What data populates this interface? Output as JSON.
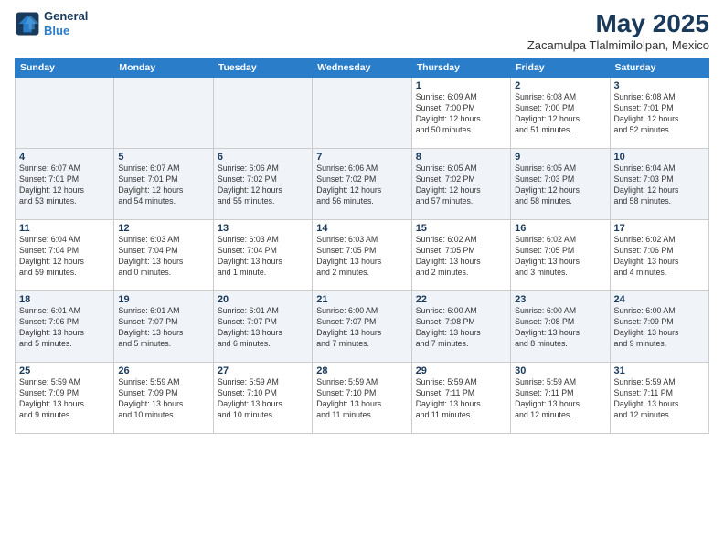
{
  "header": {
    "logo_line1": "General",
    "logo_line2": "Blue",
    "month": "May 2025",
    "location": "Zacamulpa Tlalmimilolpan, Mexico"
  },
  "days_of_week": [
    "Sunday",
    "Monday",
    "Tuesday",
    "Wednesday",
    "Thursday",
    "Friday",
    "Saturday"
  ],
  "weeks": [
    [
      {
        "num": "",
        "info": ""
      },
      {
        "num": "",
        "info": ""
      },
      {
        "num": "",
        "info": ""
      },
      {
        "num": "",
        "info": ""
      },
      {
        "num": "1",
        "info": "Sunrise: 6:09 AM\nSunset: 7:00 PM\nDaylight: 12 hours\nand 50 minutes."
      },
      {
        "num": "2",
        "info": "Sunrise: 6:08 AM\nSunset: 7:00 PM\nDaylight: 12 hours\nand 51 minutes."
      },
      {
        "num": "3",
        "info": "Sunrise: 6:08 AM\nSunset: 7:01 PM\nDaylight: 12 hours\nand 52 minutes."
      }
    ],
    [
      {
        "num": "4",
        "info": "Sunrise: 6:07 AM\nSunset: 7:01 PM\nDaylight: 12 hours\nand 53 minutes."
      },
      {
        "num": "5",
        "info": "Sunrise: 6:07 AM\nSunset: 7:01 PM\nDaylight: 12 hours\nand 54 minutes."
      },
      {
        "num": "6",
        "info": "Sunrise: 6:06 AM\nSunset: 7:02 PM\nDaylight: 12 hours\nand 55 minutes."
      },
      {
        "num": "7",
        "info": "Sunrise: 6:06 AM\nSunset: 7:02 PM\nDaylight: 12 hours\nand 56 minutes."
      },
      {
        "num": "8",
        "info": "Sunrise: 6:05 AM\nSunset: 7:02 PM\nDaylight: 12 hours\nand 57 minutes."
      },
      {
        "num": "9",
        "info": "Sunrise: 6:05 AM\nSunset: 7:03 PM\nDaylight: 12 hours\nand 58 minutes."
      },
      {
        "num": "10",
        "info": "Sunrise: 6:04 AM\nSunset: 7:03 PM\nDaylight: 12 hours\nand 58 minutes."
      }
    ],
    [
      {
        "num": "11",
        "info": "Sunrise: 6:04 AM\nSunset: 7:04 PM\nDaylight: 12 hours\nand 59 minutes."
      },
      {
        "num": "12",
        "info": "Sunrise: 6:03 AM\nSunset: 7:04 PM\nDaylight: 13 hours\nand 0 minutes."
      },
      {
        "num": "13",
        "info": "Sunrise: 6:03 AM\nSunset: 7:04 PM\nDaylight: 13 hours\nand 1 minute."
      },
      {
        "num": "14",
        "info": "Sunrise: 6:03 AM\nSunset: 7:05 PM\nDaylight: 13 hours\nand 2 minutes."
      },
      {
        "num": "15",
        "info": "Sunrise: 6:02 AM\nSunset: 7:05 PM\nDaylight: 13 hours\nand 2 minutes."
      },
      {
        "num": "16",
        "info": "Sunrise: 6:02 AM\nSunset: 7:05 PM\nDaylight: 13 hours\nand 3 minutes."
      },
      {
        "num": "17",
        "info": "Sunrise: 6:02 AM\nSunset: 7:06 PM\nDaylight: 13 hours\nand 4 minutes."
      }
    ],
    [
      {
        "num": "18",
        "info": "Sunrise: 6:01 AM\nSunset: 7:06 PM\nDaylight: 13 hours\nand 5 minutes."
      },
      {
        "num": "19",
        "info": "Sunrise: 6:01 AM\nSunset: 7:07 PM\nDaylight: 13 hours\nand 5 minutes."
      },
      {
        "num": "20",
        "info": "Sunrise: 6:01 AM\nSunset: 7:07 PM\nDaylight: 13 hours\nand 6 minutes."
      },
      {
        "num": "21",
        "info": "Sunrise: 6:00 AM\nSunset: 7:07 PM\nDaylight: 13 hours\nand 7 minutes."
      },
      {
        "num": "22",
        "info": "Sunrise: 6:00 AM\nSunset: 7:08 PM\nDaylight: 13 hours\nand 7 minutes."
      },
      {
        "num": "23",
        "info": "Sunrise: 6:00 AM\nSunset: 7:08 PM\nDaylight: 13 hours\nand 8 minutes."
      },
      {
        "num": "24",
        "info": "Sunrise: 6:00 AM\nSunset: 7:09 PM\nDaylight: 13 hours\nand 9 minutes."
      }
    ],
    [
      {
        "num": "25",
        "info": "Sunrise: 5:59 AM\nSunset: 7:09 PM\nDaylight: 13 hours\nand 9 minutes."
      },
      {
        "num": "26",
        "info": "Sunrise: 5:59 AM\nSunset: 7:09 PM\nDaylight: 13 hours\nand 10 minutes."
      },
      {
        "num": "27",
        "info": "Sunrise: 5:59 AM\nSunset: 7:10 PM\nDaylight: 13 hours\nand 10 minutes."
      },
      {
        "num": "28",
        "info": "Sunrise: 5:59 AM\nSunset: 7:10 PM\nDaylight: 13 hours\nand 11 minutes."
      },
      {
        "num": "29",
        "info": "Sunrise: 5:59 AM\nSunset: 7:11 PM\nDaylight: 13 hours\nand 11 minutes."
      },
      {
        "num": "30",
        "info": "Sunrise: 5:59 AM\nSunset: 7:11 PM\nDaylight: 13 hours\nand 12 minutes."
      },
      {
        "num": "31",
        "info": "Sunrise: 5:59 AM\nSunset: 7:11 PM\nDaylight: 13 hours\nand 12 minutes."
      }
    ]
  ]
}
